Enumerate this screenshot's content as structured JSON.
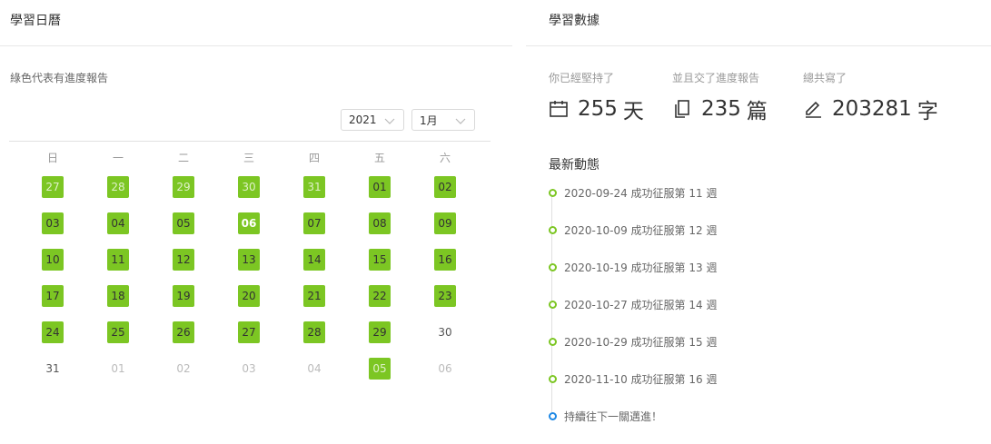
{
  "calendar": {
    "title": "學習日曆",
    "note": "綠色代表有進度報告",
    "year": "2021",
    "month": "1月",
    "weekdays": [
      "日",
      "一",
      "二",
      "三",
      "四",
      "五",
      "六"
    ],
    "weeks": [
      [
        {
          "d": "27",
          "s": "done-other"
        },
        {
          "d": "28",
          "s": "done-other"
        },
        {
          "d": "29",
          "s": "done-other"
        },
        {
          "d": "30",
          "s": "done-other"
        },
        {
          "d": "31",
          "s": "done-other"
        },
        {
          "d": "01",
          "s": "done"
        },
        {
          "d": "02",
          "s": "done"
        }
      ],
      [
        {
          "d": "03",
          "s": "done"
        },
        {
          "d": "04",
          "s": "done"
        },
        {
          "d": "05",
          "s": "done"
        },
        {
          "d": "06",
          "s": "done-today"
        },
        {
          "d": "07",
          "s": "done"
        },
        {
          "d": "08",
          "s": "done"
        },
        {
          "d": "09",
          "s": "done"
        }
      ],
      [
        {
          "d": "10",
          "s": "done"
        },
        {
          "d": "11",
          "s": "done"
        },
        {
          "d": "12",
          "s": "done"
        },
        {
          "d": "13",
          "s": "done"
        },
        {
          "d": "14",
          "s": "done"
        },
        {
          "d": "15",
          "s": "done"
        },
        {
          "d": "16",
          "s": "done"
        }
      ],
      [
        {
          "d": "17",
          "s": "done"
        },
        {
          "d": "18",
          "s": "done"
        },
        {
          "d": "19",
          "s": "done"
        },
        {
          "d": "20",
          "s": "done"
        },
        {
          "d": "21",
          "s": "done"
        },
        {
          "d": "22",
          "s": "done"
        },
        {
          "d": "23",
          "s": "done"
        }
      ],
      [
        {
          "d": "24",
          "s": "done"
        },
        {
          "d": "25",
          "s": "done"
        },
        {
          "d": "26",
          "s": "done"
        },
        {
          "d": "27",
          "s": "done"
        },
        {
          "d": "28",
          "s": "done"
        },
        {
          "d": "29",
          "s": "done"
        },
        {
          "d": "30",
          "s": "plain"
        }
      ],
      [
        {
          "d": "31",
          "s": "plain"
        },
        {
          "d": "01",
          "s": "faded"
        },
        {
          "d": "02",
          "s": "faded"
        },
        {
          "d": "03",
          "s": "faded"
        },
        {
          "d": "04",
          "s": "faded"
        },
        {
          "d": "05",
          "s": "done-other"
        },
        {
          "d": "06",
          "s": "faded"
        }
      ]
    ]
  },
  "stats": {
    "title": "學習數據",
    "days_label": "你已經堅持了",
    "days_value": "255",
    "days_unit": "天",
    "reports_label": "並且交了進度報告",
    "reports_value": "235",
    "reports_unit": "篇",
    "words_label": "總共寫了",
    "words_value": "203281",
    "words_unit": "字"
  },
  "recent": {
    "title": "最新動態",
    "items": [
      {
        "text": "2020-09-24 成功征服第 11 週",
        "color": "green"
      },
      {
        "text": "2020-10-09 成功征服第 12 週",
        "color": "green"
      },
      {
        "text": "2020-10-19 成功征服第 13 週",
        "color": "green"
      },
      {
        "text": "2020-10-27 成功征服第 14 週",
        "color": "green"
      },
      {
        "text": "2020-10-29 成功征服第 15 週",
        "color": "green"
      },
      {
        "text": "2020-11-10 成功征服第 16 週",
        "color": "green"
      },
      {
        "text": "持續往下一關邁進！",
        "color": "blue"
      }
    ]
  },
  "colors": {
    "done": "#7cc623",
    "timeline_green": "#7cc623",
    "timeline_blue": "#1e88e5"
  }
}
